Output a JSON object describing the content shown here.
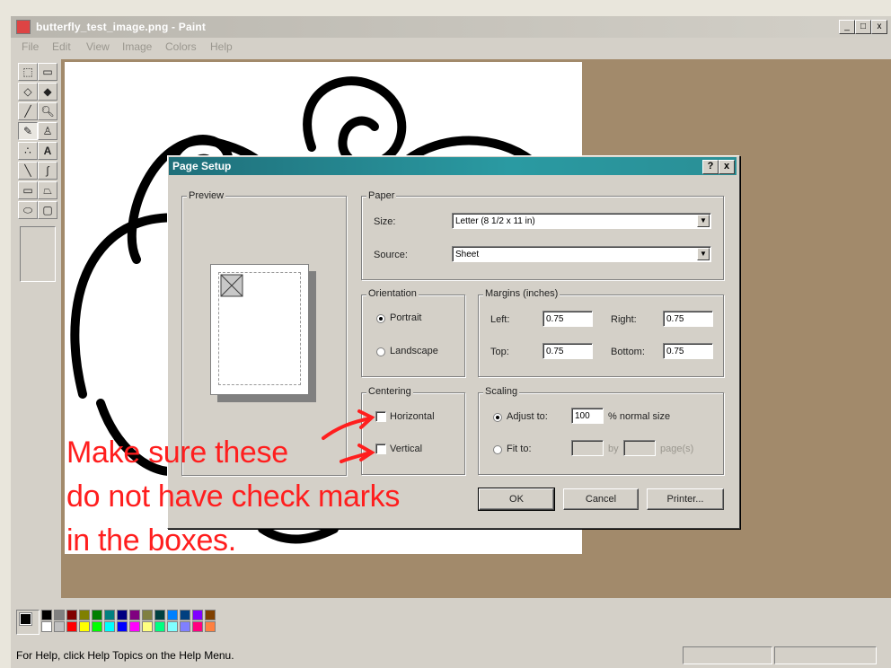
{
  "window": {
    "title": "butterfly_test_image.png - Paint",
    "controls": [
      "_",
      "□",
      "x"
    ]
  },
  "menu": [
    "File",
    "Edit",
    "View",
    "Image",
    "Colors",
    "Help"
  ],
  "dialog": {
    "title": "Page Setup",
    "help_btn": "?",
    "close_btn": "x",
    "preview_label": "Preview",
    "paper": {
      "label": "Paper",
      "size_label": "Size:",
      "size_value": "Letter (8 1/2 x 11 in)",
      "source_label": "Source:",
      "source_value": "Sheet"
    },
    "orientation": {
      "label": "Orientation",
      "portrait": "Portrait",
      "landscape": "Landscape",
      "selected": "portrait"
    },
    "margins": {
      "label": "Margins (inches)",
      "left_label": "Left:",
      "left": "0.75",
      "right_label": "Right:",
      "right": "0.75",
      "top_label": "Top:",
      "top": "0.75",
      "bottom_label": "Bottom:",
      "bottom": "0.75"
    },
    "centering": {
      "label": "Centering",
      "horizontal": "Horizontal",
      "vertical": "Vertical"
    },
    "scaling": {
      "label": "Scaling",
      "adjust_label": "Adjust to:",
      "adjust_value": "100",
      "adjust_suffix": "% normal size",
      "fit_label": "Fit to:",
      "fit_by": "by",
      "fit_suffix": "page(s)"
    },
    "buttons": {
      "ok": "OK",
      "cancel": "Cancel",
      "printer": "Printer..."
    }
  },
  "annotation": {
    "line1": "Make sure these",
    "line2": "do not have check marks",
    "line3": "in the boxes."
  },
  "status": {
    "text": "For Help, click Help Topics on the Help Menu."
  },
  "colors": {
    "palette_top": [
      "#000000",
      "#808080",
      "#800000",
      "#808000",
      "#008000",
      "#008080",
      "#000080",
      "#800080",
      "#808040",
      "#004040",
      "#0080ff",
      "#004080",
      "#8000ff",
      "#804000"
    ],
    "palette_bottom": [
      "#ffffff",
      "#c0c0c0",
      "#ff0000",
      "#ffff00",
      "#00ff00",
      "#00ffff",
      "#0000ff",
      "#ff00ff",
      "#ffff80",
      "#00ff80",
      "#80ffff",
      "#8080ff",
      "#ff0080",
      "#ff8040"
    ]
  }
}
